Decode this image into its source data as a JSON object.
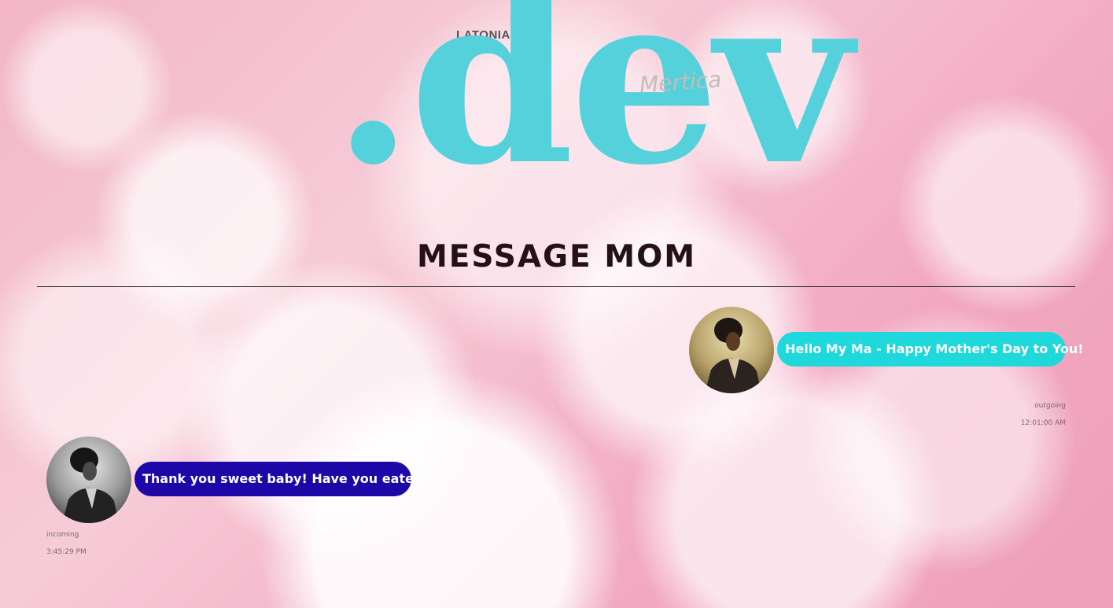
{
  "logo": {
    "top_text": "LATONIA",
    "main_text": ".dev",
    "script_text": "Mertica"
  },
  "page": {
    "title": "MESSAGE MOM"
  },
  "colors": {
    "logo_teal": "#55d1dc",
    "outgoing_bubble": "#1fd8dc",
    "incoming_bubble": "#1d07a6",
    "title_text": "#241018"
  },
  "messages": [
    {
      "text": "Hello My Ma - Happy Mother's Day to You!",
      "direction": "outgoing",
      "time": "12:01:00 AM"
    },
    {
      "text": "Thank you sweet baby! Have you eaten?",
      "direction": "incoming",
      "time": "3:45:29 PM"
    }
  ]
}
